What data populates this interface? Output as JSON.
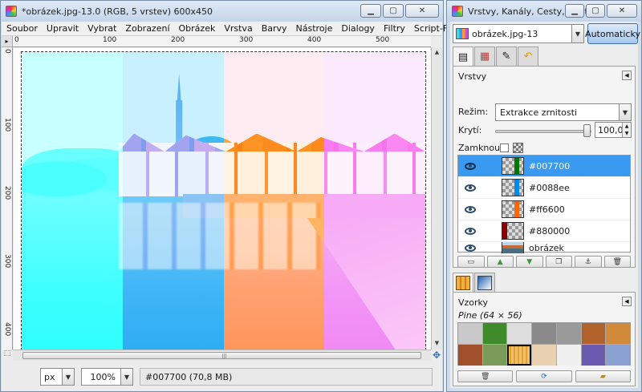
{
  "main_window": {
    "title": "*obrázek.jpg-13.0 (RGB, 5 vrstev) 600x450",
    "menu": [
      {
        "label": "Soubor"
      },
      {
        "label": "Upravit"
      },
      {
        "label": "Vybrat"
      },
      {
        "label": "Zobrazení"
      },
      {
        "label": "Obrázek"
      },
      {
        "label": "Vrstva"
      },
      {
        "label": "Barvy"
      },
      {
        "label": "Nástroje"
      },
      {
        "label": "Dialogy"
      },
      {
        "label": "Filtry"
      },
      {
        "label": "Script-Fu"
      }
    ],
    "ruler_h_ticks": [
      "0",
      "100",
      "200",
      "300",
      "400",
      "500"
    ],
    "ruler_v_ticks": [
      "0",
      "100",
      "200",
      "300",
      "400"
    ],
    "stripe_colors": [
      "#00ffff",
      "#0088ee",
      "#ff6600",
      "#ee55ee"
    ],
    "status": {
      "unit": "px",
      "zoom": "100%",
      "message": "#007700 (70,8 MB)"
    }
  },
  "dock": {
    "title": "Vrstvy, Kanály, Cesty, Zpět...",
    "image_select": "obrázek.jpg-13",
    "auto_button": "Automaticky",
    "layers_panel": {
      "title": "Vrstvy",
      "mode_label": "Režim:",
      "mode_value": "Extrakce zrnitosti",
      "opacity_label": "Krytí:",
      "opacity_value": "100,0",
      "lock_label": "Zamknout:",
      "layers": [
        {
          "name": "#007700",
          "color": "#007700",
          "selected": true
        },
        {
          "name": "#0088ee",
          "color": "#0088ee",
          "selected": false
        },
        {
          "name": "#ff6600",
          "color": "#ff6600",
          "selected": false
        },
        {
          "name": "#880000",
          "color": "#880000",
          "selected": false
        },
        {
          "name": "obrázek",
          "color": "",
          "selected": false
        }
      ]
    },
    "patterns_panel": {
      "title": "Vzorky",
      "selected_pattern": "Pine (64 × 56)",
      "patterns": [
        "#c9c9c9",
        "#3f8a2a",
        "#dedede",
        "#8a8a8a",
        "#9a9a9a",
        "#b0622a",
        "#d08a3a",
        "#a0502a",
        "#7a9a5a",
        "#f0b040",
        "#e8d0b0",
        "#f0f0f0",
        "#6a5ab0",
        "#8aa0d0"
      ]
    }
  },
  "colors": {
    "selection": "#3a99f0"
  }
}
